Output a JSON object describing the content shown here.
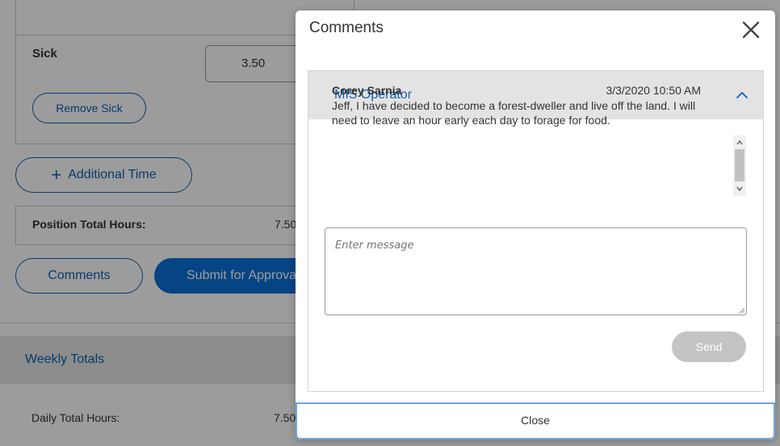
{
  "background": {
    "sick_label": "Sick",
    "sick_value": "3.50",
    "remove_sick_label": "Remove Sick",
    "additional_time_label": "Additional Time",
    "position_total_label": "Position Total Hours:",
    "position_total_value": "7.50",
    "comments_label": "Comments",
    "submit_label": "Submit for Approval",
    "weekly_totals_label": "Weekly Totals",
    "daily_total_label": "Daily Total Hours:",
    "daily_total_value": "7.50"
  },
  "modal": {
    "title": "Comments",
    "close_icon": "close-icon",
    "panel": {
      "header": "MIS Operator",
      "expanded": true,
      "messages": [
        {
          "author": "Corey Sarnia",
          "timestamp": "3/3/2020 10:50 AM",
          "body": "Jeff, I have decided to become a forest-dweller and live off the land. I will need to leave an hour early each day to forage for food."
        }
      ],
      "input_placeholder": "Enter message",
      "input_value": "",
      "send_label": "Send"
    },
    "footer_close_label": "Close"
  },
  "colors": {
    "accent": "#0d5fb5",
    "primary_button": "#0d6fd8",
    "panel_header_bg": "#e3e3e3",
    "disabled_button": "#c4c4c4"
  }
}
